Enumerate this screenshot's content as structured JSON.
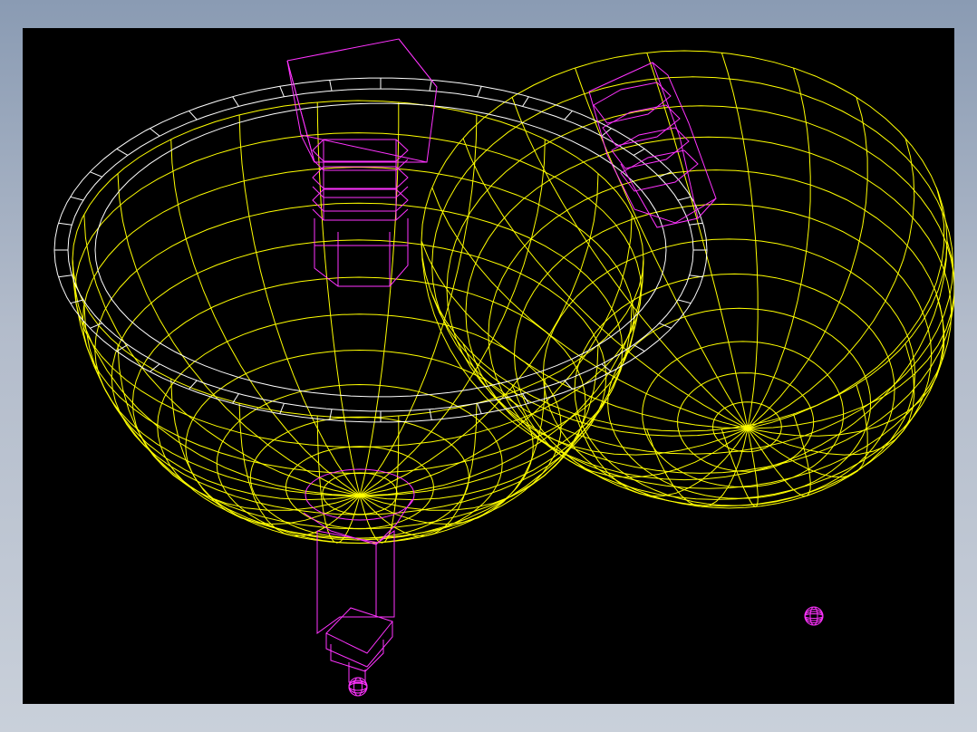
{
  "scene": {
    "kind": "cad-wireframe-viewport",
    "background": "#000000",
    "frame_color": "#9aa7bb",
    "colors": {
      "basin": "#ffff00",
      "rim": "#ffffff",
      "fitting": "#ff33ff"
    },
    "objects": [
      {
        "id": "left-basin",
        "color": "basin",
        "meridians": 22,
        "parallels": 11
      },
      {
        "id": "left-basin-rim",
        "color": "rim",
        "segments": 40
      },
      {
        "id": "right-bowl",
        "color": "basin",
        "meridians": 22,
        "parallels": 11
      },
      {
        "id": "faucet-upper",
        "color": "fitting"
      },
      {
        "id": "faucet-right",
        "color": "fitting"
      },
      {
        "id": "drain-pipe",
        "color": "fitting"
      },
      {
        "id": "small-knob",
        "color": "fitting"
      }
    ]
  }
}
